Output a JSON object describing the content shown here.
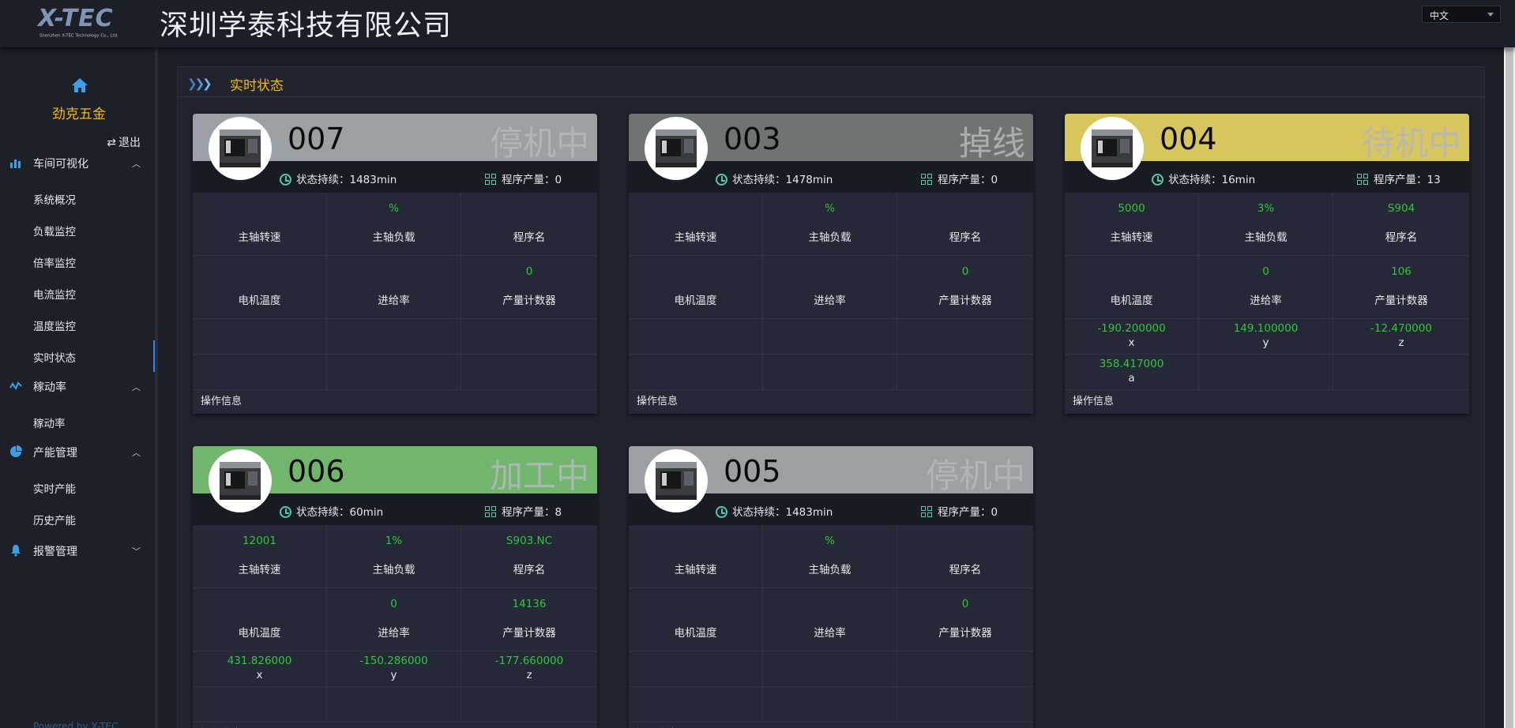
{
  "header": {
    "logo_main": "X-TEC",
    "logo_sub": "Shenzhen X-TEC Technology Co., Ltd.",
    "company_name": "深圳学泰科技有限公司",
    "language": "中文"
  },
  "sidebar": {
    "user_name": "劲克五金",
    "logout_label": "退出",
    "groups": [
      {
        "label": "车间可视化",
        "items": [
          "系统概况",
          "负载监控",
          "倍率监控",
          "电流监控",
          "温度监控",
          "实时状态"
        ]
      },
      {
        "label": "稼动率",
        "items": [
          "稼动率"
        ]
      },
      {
        "label": "产能管理",
        "items": [
          "实时产能",
          "历史产能"
        ]
      },
      {
        "label": "报警管理",
        "items": []
      }
    ],
    "active_item": "实时状态",
    "powered": "Powered by X-TEC"
  },
  "panel": {
    "title": "实时状态"
  },
  "labels": {
    "duration_prefix": "状态持续：",
    "production_prefix": "程序产量：",
    "operation_info": "操作信息",
    "spindle_speed": "主轴转速",
    "spindle_load": "主轴负载",
    "program_name": "程序名",
    "motor_temp": "电机温度",
    "feed_rate": "进给率",
    "counter": "产量计数器",
    "axis_x": "x",
    "axis_y": "y",
    "axis_z": "z",
    "axis_a": "a"
  },
  "colors": {
    "stopped": "#9aa0a3",
    "offline": "#6f7470",
    "standby": "#d7c55e",
    "processing": "#72b56d",
    "value_green": "#2fc83a",
    "accent_yellow": "#f2b90f"
  },
  "machines": [
    {
      "code": "007",
      "status": "停机中",
      "status_color": "#9aa0a3",
      "duration": "1483min",
      "production": "0",
      "spindle_speed": "",
      "spindle_load": "%",
      "program_name": "",
      "motor_temp": "",
      "feed_rate": "",
      "counter": "0",
      "x": "",
      "y": "",
      "z": "",
      "a": ""
    },
    {
      "code": "003",
      "status": "掉线",
      "status_color": "#6f7470",
      "duration": "1478min",
      "production": "0",
      "spindle_speed": "",
      "spindle_load": "%",
      "program_name": "",
      "motor_temp": "",
      "feed_rate": "",
      "counter": "0",
      "x": "",
      "y": "",
      "z": "",
      "a": ""
    },
    {
      "code": "004",
      "status": "待机中",
      "status_color": "#d7c55e",
      "duration": "16min",
      "production": "13",
      "spindle_speed": "5000",
      "spindle_load": "3%",
      "program_name": "S904",
      "motor_temp": "",
      "feed_rate": "0",
      "counter": "106",
      "x": "-190.200000",
      "y": "149.100000",
      "z": "-12.470000",
      "a": "358.417000"
    },
    {
      "code": "006",
      "status": "加工中",
      "status_color": "#72b56d",
      "duration": "60min",
      "production": "8",
      "spindle_speed": "12001",
      "spindle_load": "1%",
      "program_name": "S903.NC",
      "motor_temp": "",
      "feed_rate": "0",
      "counter": "14136",
      "x": "431.826000",
      "y": "-150.286000",
      "z": "-177.660000",
      "a": ""
    },
    {
      "code": "005",
      "status": "停机中",
      "status_color": "#9aa0a3",
      "duration": "1483min",
      "production": "0",
      "spindle_speed": "",
      "spindle_load": "%",
      "program_name": "",
      "motor_temp": "",
      "feed_rate": "",
      "counter": "0",
      "x": "",
      "y": "",
      "z": "",
      "a": ""
    }
  ]
}
